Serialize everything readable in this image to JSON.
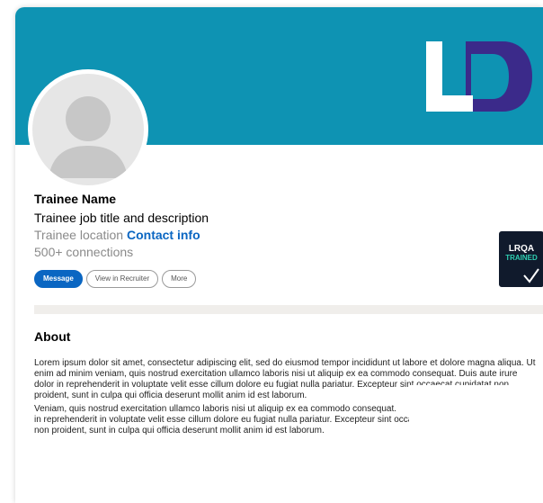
{
  "profile": {
    "name": "Trainee Name",
    "job_title": "Trainee job title and description",
    "location": "Trainee location",
    "contact_label": "Contact info",
    "connections": "500+ connections"
  },
  "actions": {
    "message": "Message",
    "recruiter": "View in Recruiter",
    "more": "More"
  },
  "badge": {
    "line1": "LRQA",
    "line2": "TRAINED"
  },
  "banner": {
    "logo_text": "LD",
    "color": "#0e93b3"
  },
  "about": {
    "title": "About",
    "para1": "Lorem ipsum dolor sit amet, consectetur adipiscing elit, sed do eiusmod tempor incididunt ut labore et dolore magna aliqua. Ut enim ad minim veniam, quis nostrud exercitation ullamco laboris nisi ut aliquip ex ea commodo consequat. Duis aute irure dolor in reprehenderit in voluptate velit esse cillum dolore eu fugiat nulla pariatur. Excepteur sint occaecat cupidatat non proident, sunt in culpa qui officia deserunt mollit anim id est laborum.",
    "para2_line1": "Veniam, quis nostrud exercitation ullamco laboris nisi ut aliquip ex ea commodo consequat.",
    "para2_line2": "in reprehenderit in voluptate velit esse cillum dolore eu fugiat nulla pariatur. Excepteur sint occaecat cupidatat",
    "para2_line3": "non proident, sunt in culpa qui officia deserunt mollit anim id est laborum."
  },
  "colors": {
    "banner": "#0e93b3",
    "link": "#0a66c2",
    "logo_dark": "#3b2a8a",
    "badge_bg": "#101a2c",
    "badge_accent": "#2fd1b3"
  }
}
